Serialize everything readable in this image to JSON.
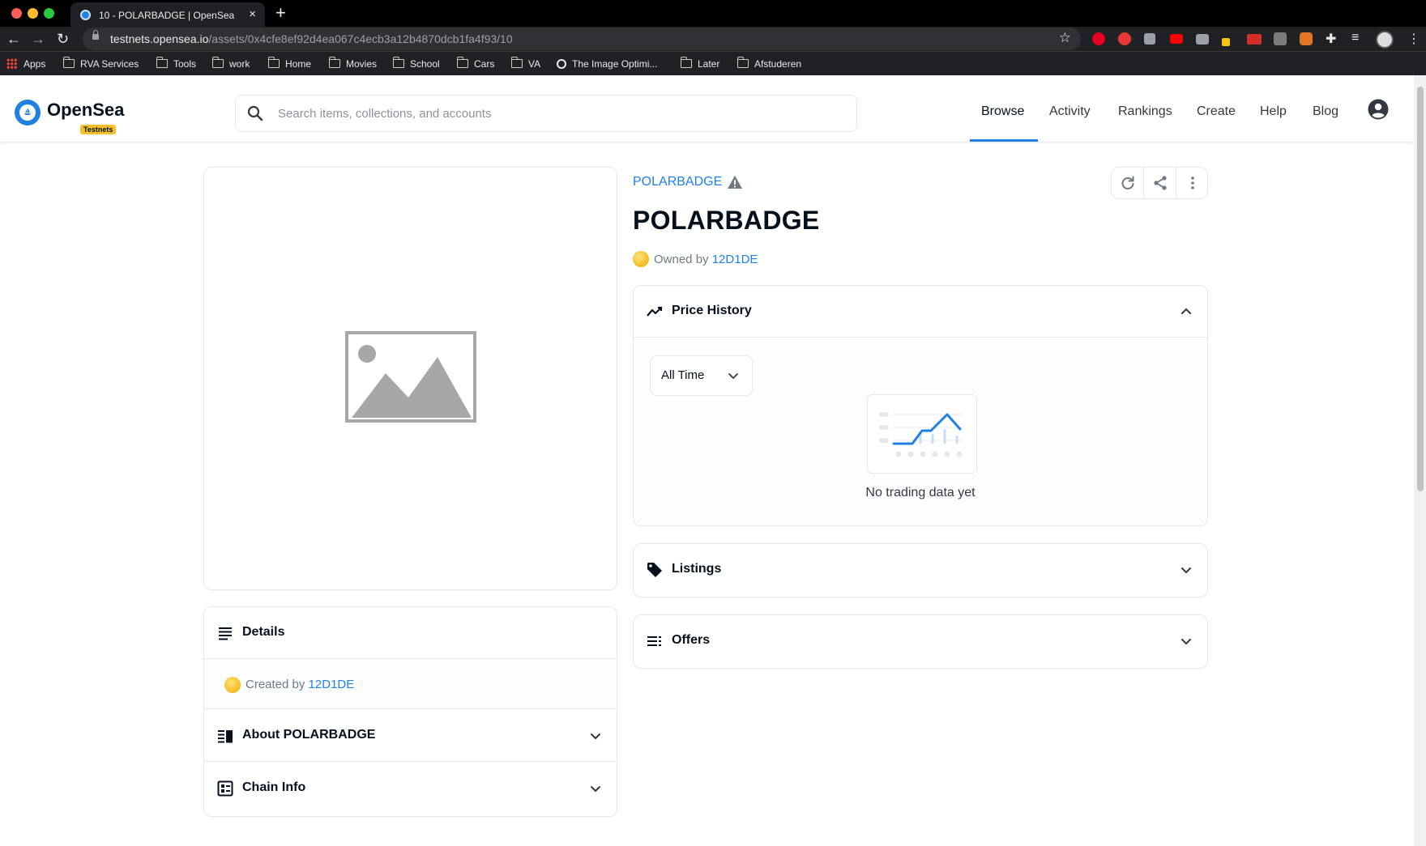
{
  "browser": {
    "tab_title": "10 - POLARBADGE | OpenSea",
    "url_host": "testnets.opensea.io",
    "url_path": "/assets/0x4cfe8ef92d4ea067c4ecb3a12b4870dcb1fa4f93/10",
    "bookmarks": [
      "Apps",
      "RVA Services",
      "Tools",
      "work",
      "Home",
      "Movies",
      "School",
      "Cars",
      "VA",
      "The Image Optimi...",
      "Later",
      "Afstuderen"
    ]
  },
  "header": {
    "logo_text": "OpenSea",
    "badge": "Testnets",
    "search_placeholder": "Search items, collections, and accounts",
    "nav": [
      "Browse",
      "Activity",
      "Rankings",
      "Create",
      "Help",
      "Blog"
    ],
    "active_nav": "Browse"
  },
  "asset": {
    "collection": "POLARBADGE",
    "title": "POLARBADGE",
    "owned_by_label": "Owned by",
    "owner": "12D1DE"
  },
  "details": {
    "title": "Details",
    "created_by_label": "Created by",
    "creator": "12D1DE",
    "about_title": "About POLARBADGE",
    "chain_title": "Chain Info"
  },
  "price_history": {
    "title": "Price History",
    "range": "All Time",
    "empty_text": "No trading data yet"
  },
  "listings": {
    "title": "Listings"
  },
  "offers": {
    "title": "Offers"
  },
  "colors": {
    "accent": "#2081e2",
    "badge": "#f7c02a",
    "text": "#04111d"
  }
}
